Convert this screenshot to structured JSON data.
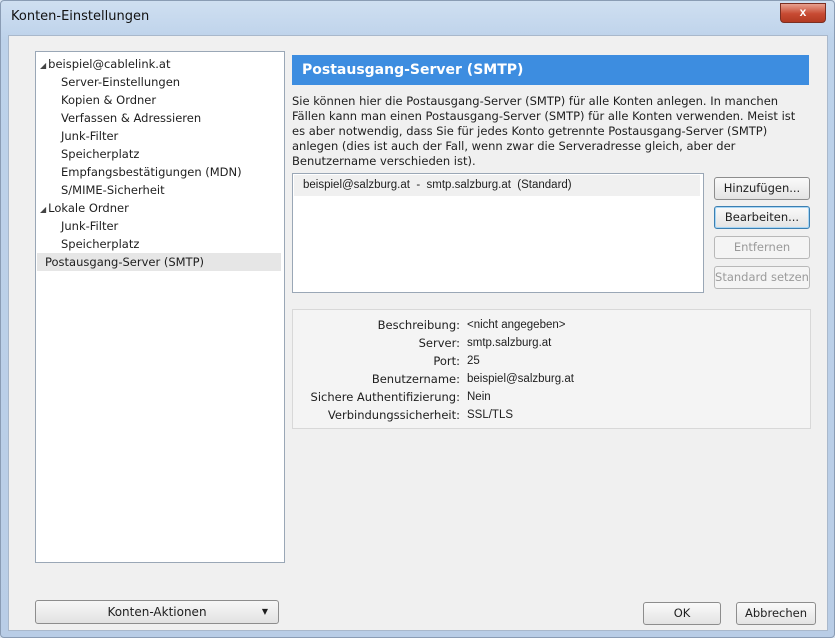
{
  "window": {
    "title": "Konten-Einstellungen",
    "close_label": "x"
  },
  "tree": {
    "items": [
      {
        "label": "beispiel@cablelink.at",
        "level": 0,
        "expanded": true
      },
      {
        "label": "Server-Einstellungen",
        "level": 1
      },
      {
        "label": "Kopien & Ordner",
        "level": 1
      },
      {
        "label": "Verfassen & Adressieren",
        "level": 1
      },
      {
        "label": "Junk-Filter",
        "level": 1
      },
      {
        "label": "Speicherplatz",
        "level": 1
      },
      {
        "label": "Empfangsbestätigungen (MDN)",
        "level": 1
      },
      {
        "label": "S/MIME-Sicherheit",
        "level": 1
      },
      {
        "label": "Lokale Ordner",
        "level": 0,
        "expanded": true
      },
      {
        "label": "Junk-Filter",
        "level": 1
      },
      {
        "label": "Speicherplatz",
        "level": 1
      },
      {
        "label": "Postausgang-Server (SMTP)",
        "level": 0,
        "selected": true
      }
    ],
    "actions_button": "Konten-Aktionen"
  },
  "main": {
    "header": "Postausgang-Server (SMTP)",
    "description_lines": [
      "Sie können hier die Postausgang-Server (SMTP) für alle Konten anlegen. In manchen",
      "Fällen kann man einen Postausgang-Server (SMTP) für alle Konten verwenden. Meist ist",
      "es aber notwendig, dass Sie für jedes Konto getrennte Postausgang-Server (SMTP)",
      "anlegen (dies ist auch der Fall, wenn zwar die Serveradresse gleich, aber der",
      "Benutzername verschieden ist)."
    ],
    "server_list": [
      "beispiel@salzburg.at  -  smtp.salzburg.at  (Standard)"
    ],
    "buttons": {
      "add": "Hinzufügen...",
      "edit": "Bearbeiten...",
      "remove": "Entfernen",
      "set_default": "Standard setzen"
    },
    "details": {
      "description_label": "Beschreibung:",
      "description_value": "<nicht angegeben>",
      "server_label": "Server:",
      "server_value": "smtp.salzburg.at",
      "port_label": "Port:",
      "port_value": "25",
      "username_label": "Benutzername:",
      "username_value": "beispiel@salzburg.at",
      "auth_label": "Sichere Authentifizierung:",
      "auth_value": "Nein",
      "security_label": "Verbindungssicherheit:",
      "security_value": "SSL/TLS"
    }
  },
  "footer": {
    "ok": "OK",
    "cancel": "Abbrechen"
  }
}
